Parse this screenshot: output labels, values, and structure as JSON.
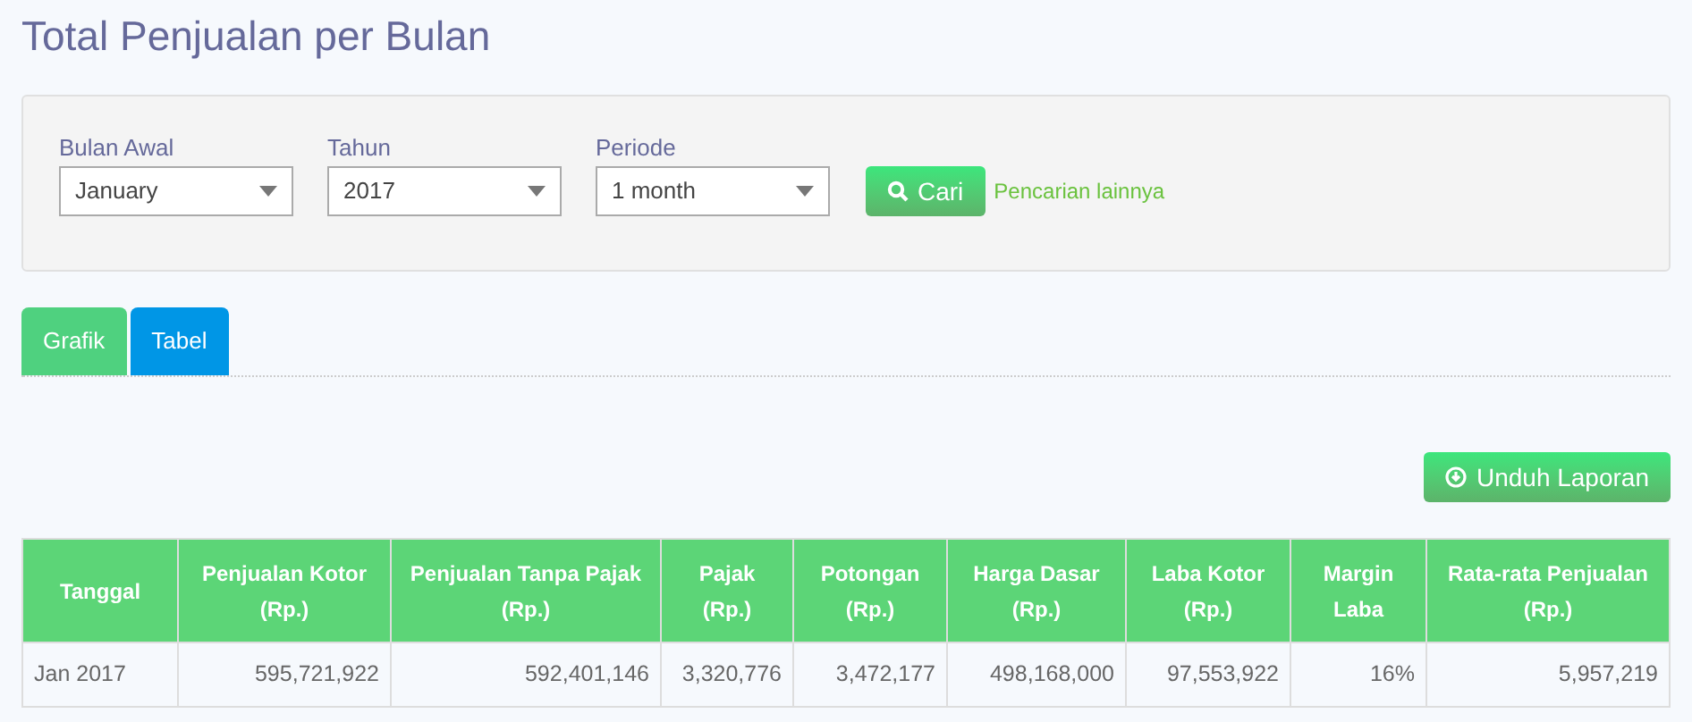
{
  "title": "Total Penjualan per Bulan",
  "filters": [
    {
      "label": "Bulan Awal",
      "value": "January"
    },
    {
      "label": "Tahun",
      "value": "2017"
    },
    {
      "label": "Periode",
      "value": "1 month"
    }
  ],
  "search_button": "Cari",
  "more_link": "Pencarian lainnya",
  "tabs": [
    {
      "label": "Grafik",
      "selected": false
    },
    {
      "label": "Tabel",
      "selected": true
    }
  ],
  "download_button": "Unduh Laporan",
  "table": {
    "columns": [
      {
        "lines": [
          "Tanggal"
        ]
      },
      {
        "lines": [
          "Penjualan Kotor",
          "(Rp.)"
        ]
      },
      {
        "lines": [
          "Penjualan Tanpa Pajak",
          "(Rp.)"
        ]
      },
      {
        "lines": [
          "Pajak",
          "(Rp.)"
        ]
      },
      {
        "lines": [
          "Potongan",
          "(Rp.)"
        ]
      },
      {
        "lines": [
          "Harga Dasar",
          "(Rp.)"
        ]
      },
      {
        "lines": [
          "Laba Kotor",
          "(Rp.)"
        ]
      },
      {
        "lines": [
          "Margin",
          "Laba"
        ]
      },
      {
        "lines": [
          "Rata-rata Penjualan",
          "(Rp.)"
        ]
      }
    ],
    "rows": [
      [
        "Jan 2017",
        "595,721,922",
        "592,401,146",
        "3,320,776",
        "3,472,177",
        "498,168,000",
        "97,553,922",
        "16%",
        "5,957,219"
      ]
    ]
  }
}
